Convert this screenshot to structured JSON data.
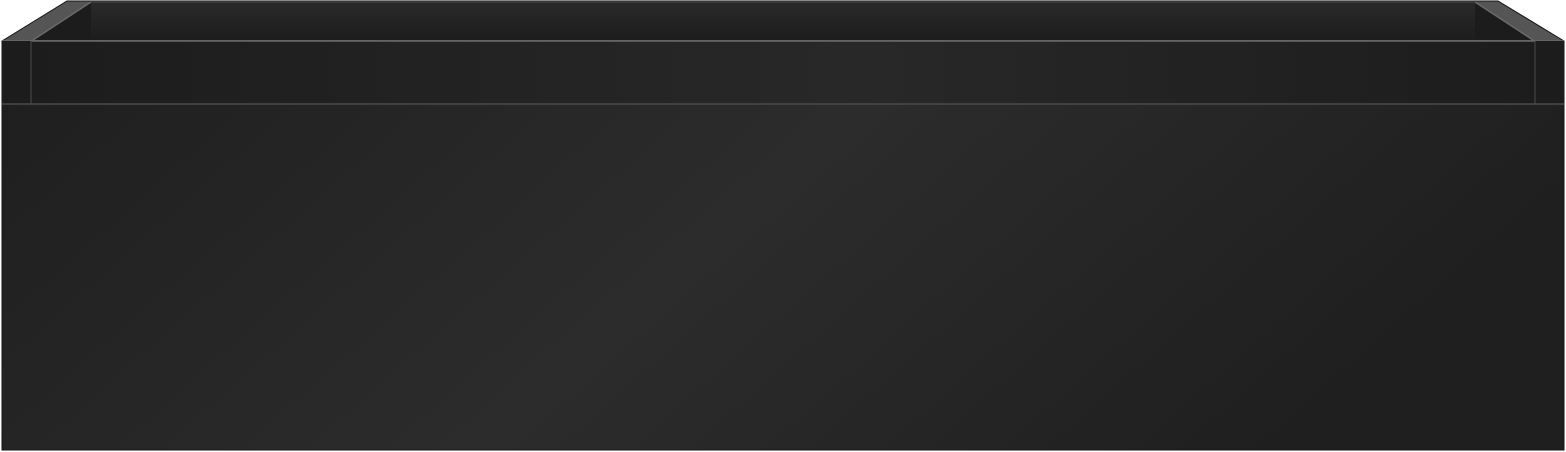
{
  "scene": {
    "subject": "drawer-box",
    "colors": {
      "background": "#ffffff",
      "front_dark": "#1f1f1f",
      "front_light": "#2c2c2c",
      "top_panel": "#555555",
      "top_panel_edge": "#6a6a6a",
      "interior_back": "#2a2a2a",
      "interior_side": "#1c1c1c",
      "back_rim": "#3a3a3a",
      "edge_highlight": "#4a4a4a",
      "outline": "#151515"
    }
  }
}
